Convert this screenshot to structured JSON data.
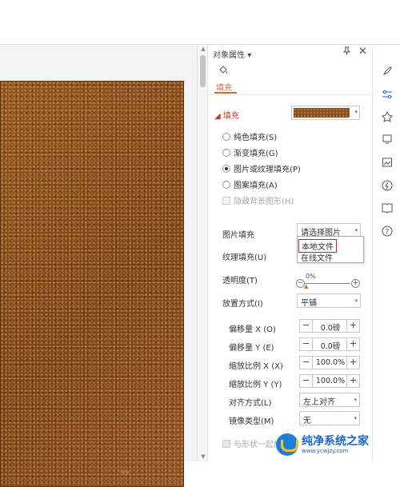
{
  "panel": {
    "title": "对象属性",
    "title_arrow": "▾",
    "tab_fill": "填充",
    "section_fill": "填充",
    "section_marker": "◢"
  },
  "fill_options": [
    {
      "label": "纯色填充(S)",
      "selected": false
    },
    {
      "label": "渐变填充(G)",
      "selected": false
    },
    {
      "label": "图片或纹理填充(P)",
      "selected": true
    },
    {
      "label": "图案填充(A)",
      "selected": false
    }
  ],
  "hide_bg_graphics": {
    "label": "隐藏背景图形(H)",
    "checked": false,
    "disabled": true
  },
  "picture_fill": {
    "label": "图片填充",
    "value": "请选择图片"
  },
  "picture_menu": {
    "items": [
      "本地文件",
      "在线文件"
    ],
    "highlighted": "本地文件"
  },
  "texture_fill": {
    "label": "纹理填充(U)"
  },
  "transparency": {
    "label": "透明度(T)",
    "value": "0%",
    "percent": 0
  },
  "placement": {
    "label": "放置方式(I)",
    "value": "平铺"
  },
  "offset_x": {
    "label": "偏移量 X (O)",
    "value": "0.0磅",
    "minus": "−",
    "plus": "+"
  },
  "offset_y": {
    "label": "偏移量 Y (E)",
    "value": "0.0磅",
    "minus": "−",
    "plus": "+"
  },
  "scale_x": {
    "label": "缩放比例 X (X)",
    "value": "100.0%",
    "minus": "−",
    "plus": "+"
  },
  "scale_y": {
    "label": "缩放比例 Y (Y)",
    "value": "100.0%",
    "minus": "−",
    "plus": "+"
  },
  "alignment": {
    "label": "对齐方式(L)",
    "value": "左上对齐"
  },
  "mirror": {
    "label": "镜像类型(M)",
    "value": "无"
  },
  "rotate_with_shape": {
    "label": "与形状一起旋转",
    "checked": true,
    "disabled": true
  },
  "canvas_marker": "«»",
  "watermark": {
    "title": "纯净系统之家",
    "url": "www.ycwjzy.com"
  },
  "colors": {
    "accent": "#d2693c",
    "highlight_border": "#d82020",
    "leather": "#8a5020"
  }
}
